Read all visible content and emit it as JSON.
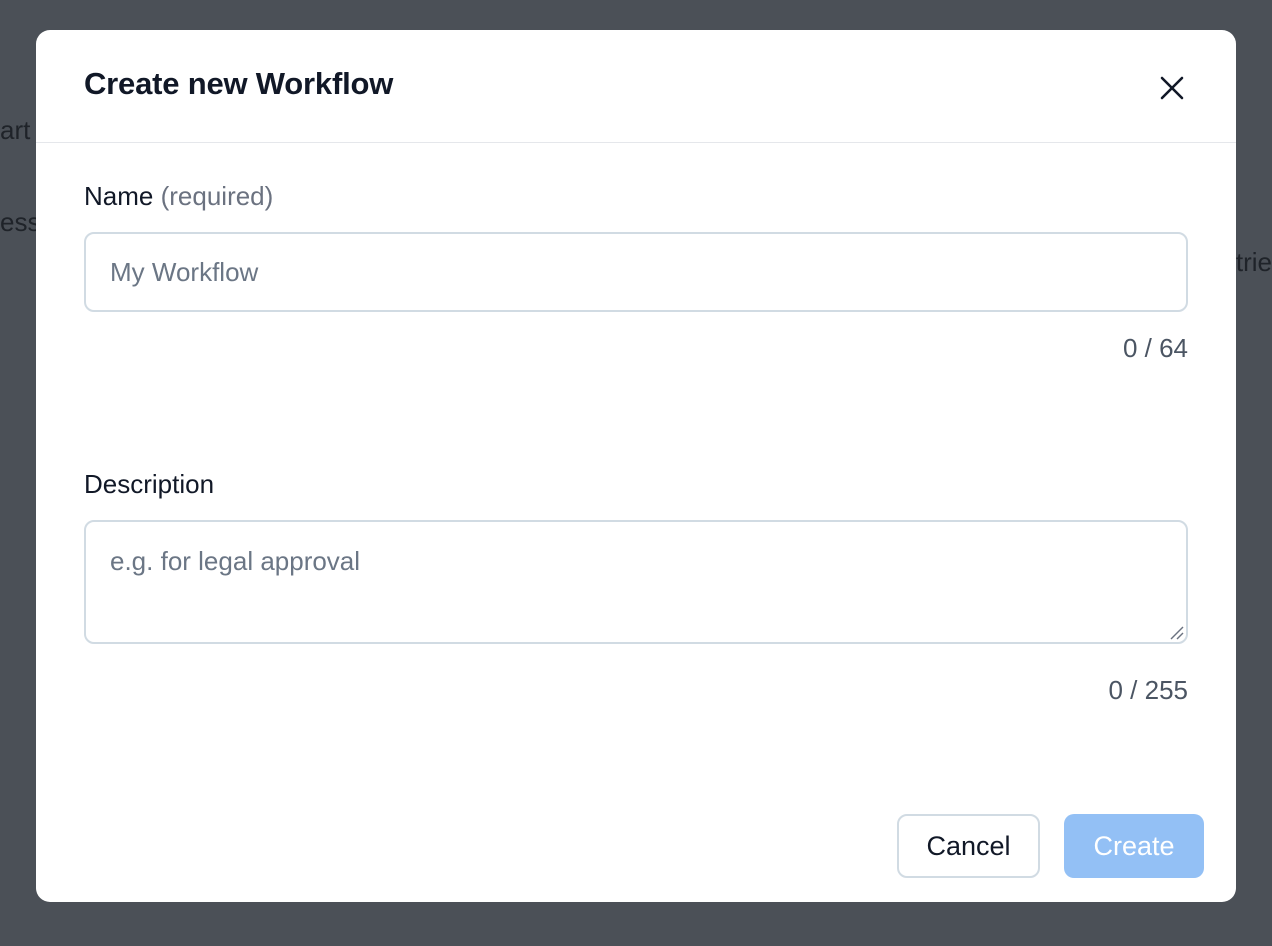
{
  "background": {
    "fragments": [
      "art",
      "ess",
      "trie"
    ]
  },
  "modal": {
    "title": "Create new Workflow",
    "close_icon": "close-icon",
    "name_field": {
      "label": "Name",
      "hint": "(required)",
      "placeholder": "My Workflow",
      "value": "",
      "counter": "0 / 64"
    },
    "description_field": {
      "label": "Description",
      "placeholder": "e.g. for legal approval",
      "value": "",
      "counter": "0 / 255"
    },
    "buttons": {
      "cancel_label": "Cancel",
      "create_label": "Create"
    }
  },
  "colors": {
    "overlay": "#4b5057",
    "primary_disabled": "#93c0f5",
    "border": "#d1dbe3",
    "text": "#111827"
  }
}
